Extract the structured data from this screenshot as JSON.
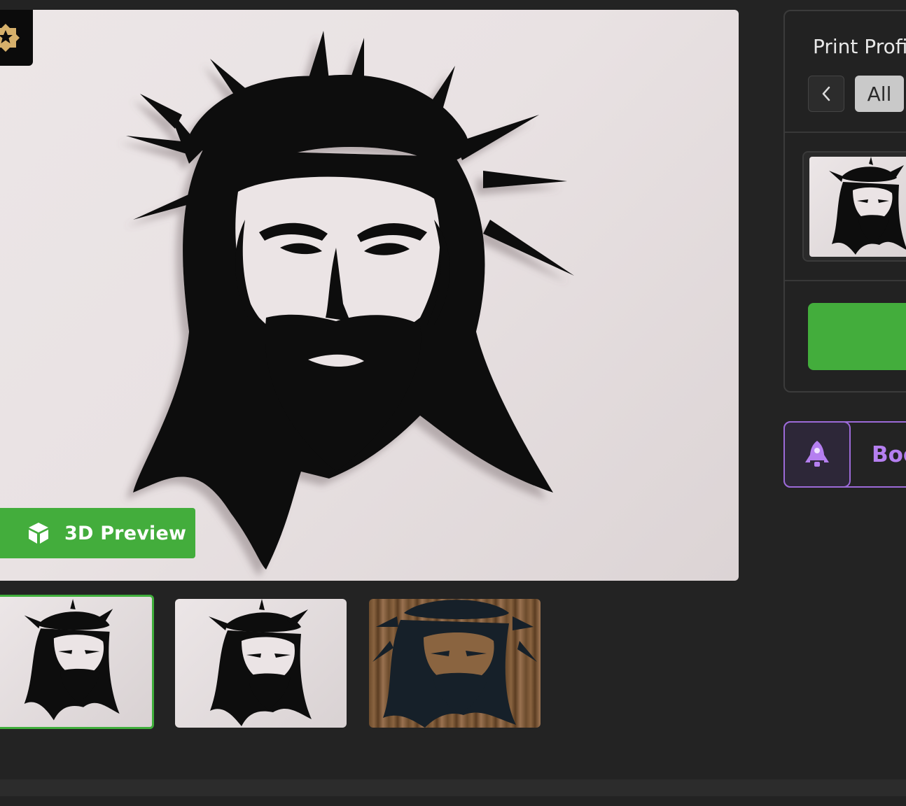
{
  "gallery": {
    "preview_button_label": "3D Preview",
    "badge_icon": "star-badge-icon",
    "thumbnails": [
      {
        "name": "thumbnail-1",
        "background": "wall",
        "selected": true
      },
      {
        "name": "thumbnail-2",
        "background": "wall",
        "selected": false
      },
      {
        "name": "thumbnail-3",
        "background": "wood",
        "selected": false
      }
    ]
  },
  "print_profile": {
    "title": "Print Profi",
    "filter_all_label": "All",
    "prev_icon": "chevron-left-icon"
  },
  "boost": {
    "label": "Boo",
    "icon": "rocket-icon"
  },
  "colors": {
    "accent_green": "#43ad3c",
    "boost_purple": "#9c6ad8",
    "background": "#232323"
  }
}
